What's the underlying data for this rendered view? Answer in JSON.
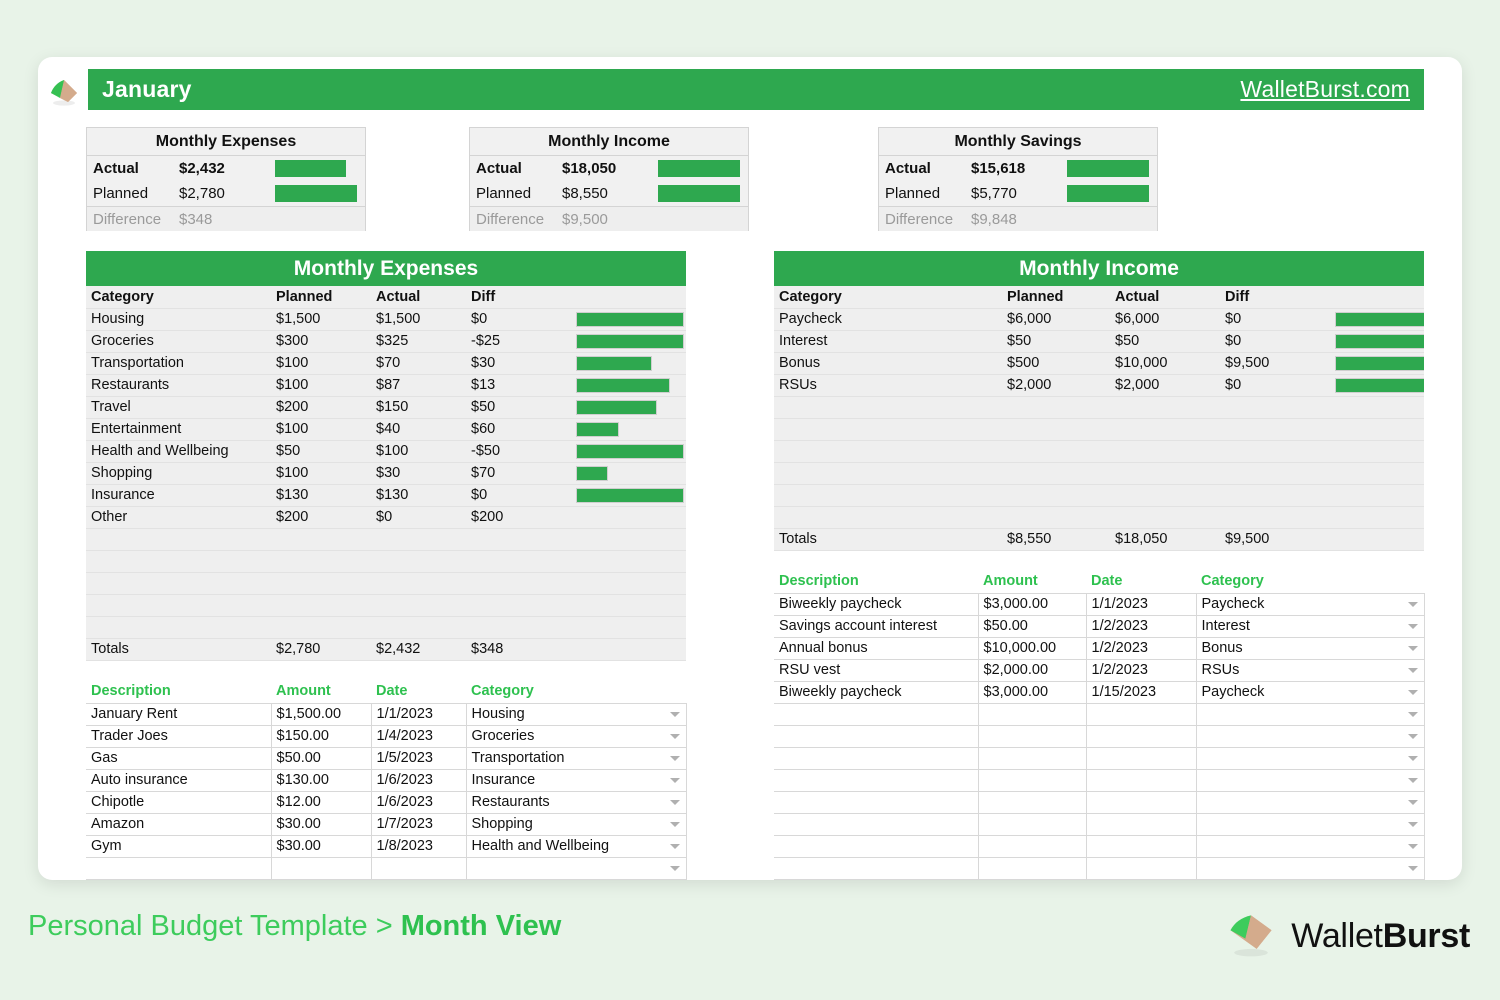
{
  "header": {
    "month": "January",
    "site": "WalletBurst.com",
    "logo_icon": "walletburst-fan-logo"
  },
  "summary_cards": [
    {
      "title": "Monthly Expenses",
      "actual_label": "Actual",
      "actual_value": "$2,432",
      "planned_label": "Planned",
      "planned_value": "$2,780",
      "difference_label": "Difference",
      "difference_value": "$348",
      "actual_bar_pct": 87,
      "planned_bar_pct": 100
    },
    {
      "title": "Monthly Income",
      "actual_label": "Actual",
      "actual_value": "$18,050",
      "planned_label": "Planned",
      "planned_value": "$8,550",
      "difference_label": "Difference",
      "difference_value": "$9,500",
      "actual_bar_pct": 100,
      "planned_bar_pct": 100
    },
    {
      "title": "Monthly Savings",
      "actual_label": "Actual",
      "actual_value": "$15,618",
      "planned_label": "Planned",
      "planned_value": "$5,770",
      "difference_label": "Difference",
      "difference_value": "$9,848",
      "actual_bar_pct": 100,
      "planned_bar_pct": 100
    }
  ],
  "expenses_table": {
    "title": "Monthly Expenses",
    "columns": [
      "Category",
      "Planned",
      "Actual",
      "Diff"
    ],
    "rows": [
      {
        "category": "Housing",
        "planned": "$1,500",
        "actual": "$1,500",
        "diff": "$0",
        "negative": false,
        "bar_pct": 100
      },
      {
        "category": "Groceries",
        "planned": "$300",
        "actual": "$325",
        "diff": "-$25",
        "negative": true,
        "bar_pct": 100
      },
      {
        "category": "Transportation",
        "planned": "$100",
        "actual": "$70",
        "diff": "$30",
        "negative": false,
        "bar_pct": 70
      },
      {
        "category": "Restaurants",
        "planned": "$100",
        "actual": "$87",
        "diff": "$13",
        "negative": false,
        "bar_pct": 87
      },
      {
        "category": "Travel",
        "planned": "$200",
        "actual": "$150",
        "diff": "$50",
        "negative": false,
        "bar_pct": 75
      },
      {
        "category": "Entertainment",
        "planned": "$100",
        "actual": "$40",
        "diff": "$60",
        "negative": false,
        "bar_pct": 40
      },
      {
        "category": "Health and Wellbeing",
        "planned": "$50",
        "actual": "$100",
        "diff": "-$50",
        "negative": true,
        "bar_pct": 100
      },
      {
        "category": "Shopping",
        "planned": "$100",
        "actual": "$30",
        "diff": "$70",
        "negative": false,
        "bar_pct": 30
      },
      {
        "category": "Insurance",
        "planned": "$130",
        "actual": "$130",
        "diff": "$0",
        "negative": false,
        "bar_pct": 100
      },
      {
        "category": "Other",
        "planned": "$200",
        "actual": "$0",
        "diff": "$200",
        "negative": false,
        "bar_pct": 0
      }
    ],
    "blank_rows": 5,
    "totals": {
      "label": "Totals",
      "planned": "$2,780",
      "actual": "$2,432",
      "diff": "$348"
    }
  },
  "income_table": {
    "title": "Monthly Income",
    "columns": [
      "Category",
      "Planned",
      "Actual",
      "Diff"
    ],
    "rows": [
      {
        "category": "Paycheck",
        "planned": "$6,000",
        "actual": "$6,000",
        "diff": "$0",
        "negative": false,
        "bar_pct": 100
      },
      {
        "category": "Interest",
        "planned": "$50",
        "actual": "$50",
        "diff": "$0",
        "negative": false,
        "bar_pct": 100
      },
      {
        "category": "Bonus",
        "planned": "$500",
        "actual": "$10,000",
        "diff": "$9,500",
        "negative": false,
        "bar_pct": 100
      },
      {
        "category": "RSUs",
        "planned": "$2,000",
        "actual": "$2,000",
        "diff": "$0",
        "negative": false,
        "bar_pct": 100
      }
    ],
    "blank_rows": 6,
    "totals": {
      "label": "Totals",
      "planned": "$8,550",
      "actual": "$18,050",
      "diff": "$9,500"
    }
  },
  "expenses_transactions": {
    "columns": [
      "Description",
      "Amount",
      "Date",
      "Category"
    ],
    "rows": [
      {
        "description": "January Rent",
        "amount": "$1,500.00",
        "date": "1/1/2023",
        "category": "Housing"
      },
      {
        "description": "Trader Joes",
        "amount": "$150.00",
        "date": "1/4/2023",
        "category": "Groceries"
      },
      {
        "description": "Gas",
        "amount": "$50.00",
        "date": "1/5/2023",
        "category": "Transportation"
      },
      {
        "description": "Auto insurance",
        "amount": "$130.00",
        "date": "1/6/2023",
        "category": "Insurance"
      },
      {
        "description": "Chipotle",
        "amount": "$12.00",
        "date": "1/6/2023",
        "category": "Restaurants"
      },
      {
        "description": "Amazon",
        "amount": "$30.00",
        "date": "1/7/2023",
        "category": "Shopping"
      },
      {
        "description": "Gym",
        "amount": "$30.00",
        "date": "1/8/2023",
        "category": "Health and Wellbeing"
      }
    ],
    "blank_rows": 1
  },
  "income_transactions": {
    "columns": [
      "Description",
      "Amount",
      "Date",
      "Category"
    ],
    "rows": [
      {
        "description": "Biweekly paycheck",
        "amount": "$3,000.00",
        "date": "1/1/2023",
        "category": "Paycheck"
      },
      {
        "description": "Savings account interest",
        "amount": "$50.00",
        "date": "1/2/2023",
        "category": "Interest"
      },
      {
        "description": "Annual bonus",
        "amount": "$10,000.00",
        "date": "1/2/2023",
        "category": "Bonus"
      },
      {
        "description": "RSU vest",
        "amount": "$2,000.00",
        "date": "1/2/2023",
        "category": "RSUs"
      },
      {
        "description": "Biweekly paycheck",
        "amount": "$3,000.00",
        "date": "1/15/2023",
        "category": "Paycheck"
      }
    ],
    "blank_rows": 8
  },
  "footer": {
    "breadcrumb_prefix": "Personal Budget Template > ",
    "breadcrumb_current": "Month View",
    "brand_light": "Wallet",
    "brand_bold": "Burst",
    "brand_logo_icon": "walletburst-fan-logo"
  },
  "colors": {
    "accent_green": "#2ea84f",
    "bright_green": "#3dcc5c",
    "negative_red": "#f03232",
    "muted_gray": "#9a9a9a",
    "page_background": "#e8f3e8",
    "logo_tan": "#d4ab8c"
  }
}
